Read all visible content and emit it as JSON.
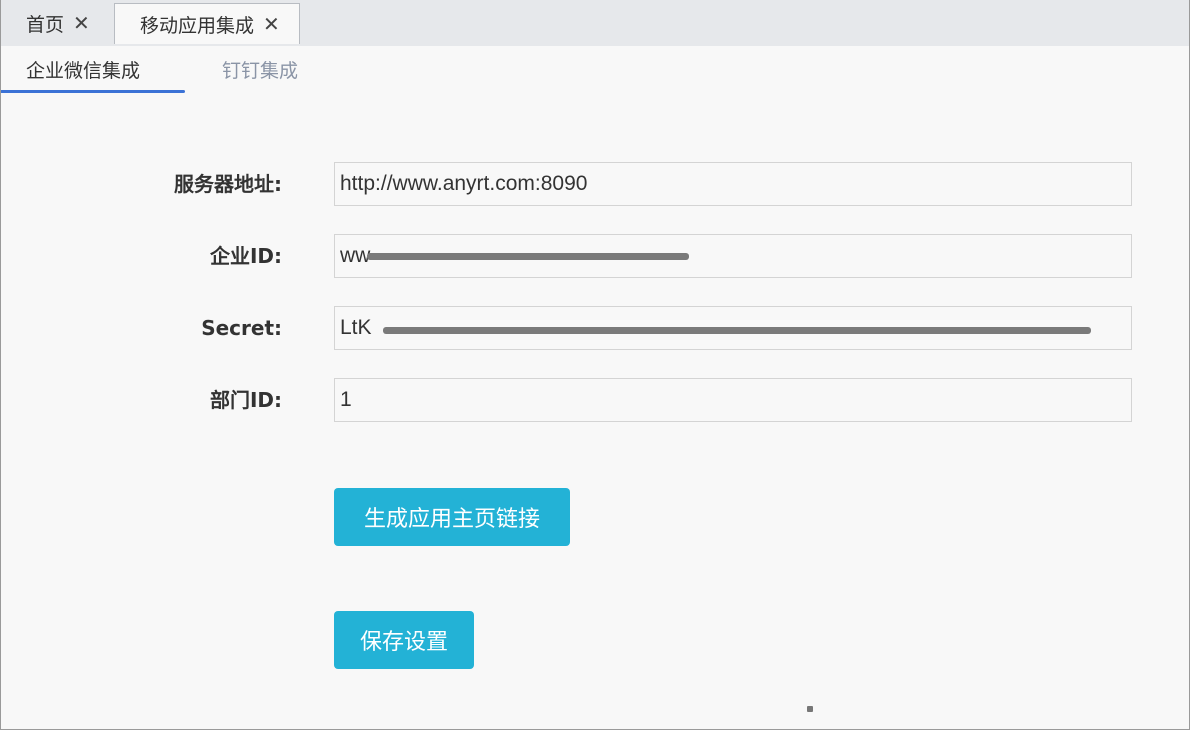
{
  "tabs": [
    {
      "label": "首页",
      "close": "✕"
    },
    {
      "label": "移动应用集成",
      "close": "✕"
    }
  ],
  "subtabs": {
    "wechat": "企业微信集成",
    "dingtalk": "钉钉集成"
  },
  "form": {
    "server_label": "服务器地址:",
    "server_value": "http://www.anyrt.com:8090",
    "corp_label": "企业ID:",
    "corp_value": "ww",
    "secret_label": "Secret:",
    "secret_value": "LtK",
    "dept_label": "部门ID:",
    "dept_value": "1"
  },
  "buttons": {
    "generate": "生成应用主页链接",
    "save": "保存设置"
  },
  "colors": {
    "accent": "#23b2d6",
    "tab_underline": "#3b72d6"
  }
}
